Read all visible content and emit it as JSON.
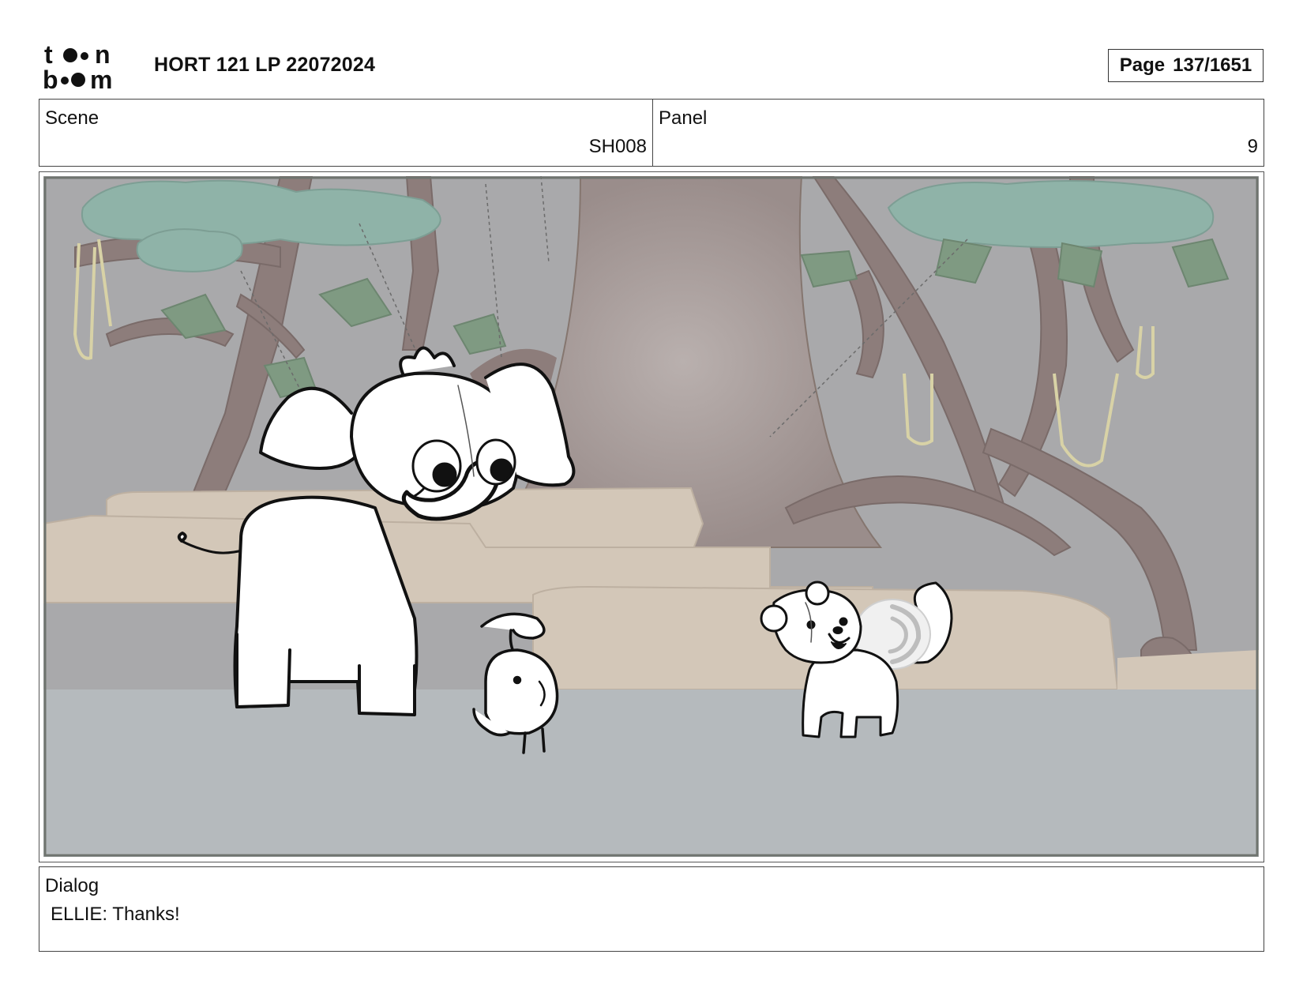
{
  "header": {
    "logo_top": "to n",
    "logo_bottom": "b m",
    "title": "HORT 121 LP 22072024",
    "page_label": "Page",
    "page_value": "137/1651"
  },
  "info": {
    "scene_label": "Scene",
    "scene_value": "SH008",
    "panel_label": "Panel",
    "panel_value": "9"
  },
  "dialog": {
    "label": "Dialog",
    "text": "ELLIE: Thanks!"
  },
  "icons": {
    "logo": "toonboom-logo"
  },
  "colors": {
    "sky": "#a9a9ab",
    "ground": "#b5babd",
    "trunk": "#8d7d7b",
    "foliage": "#8fb3a8",
    "stone": "#d3c7b8"
  }
}
